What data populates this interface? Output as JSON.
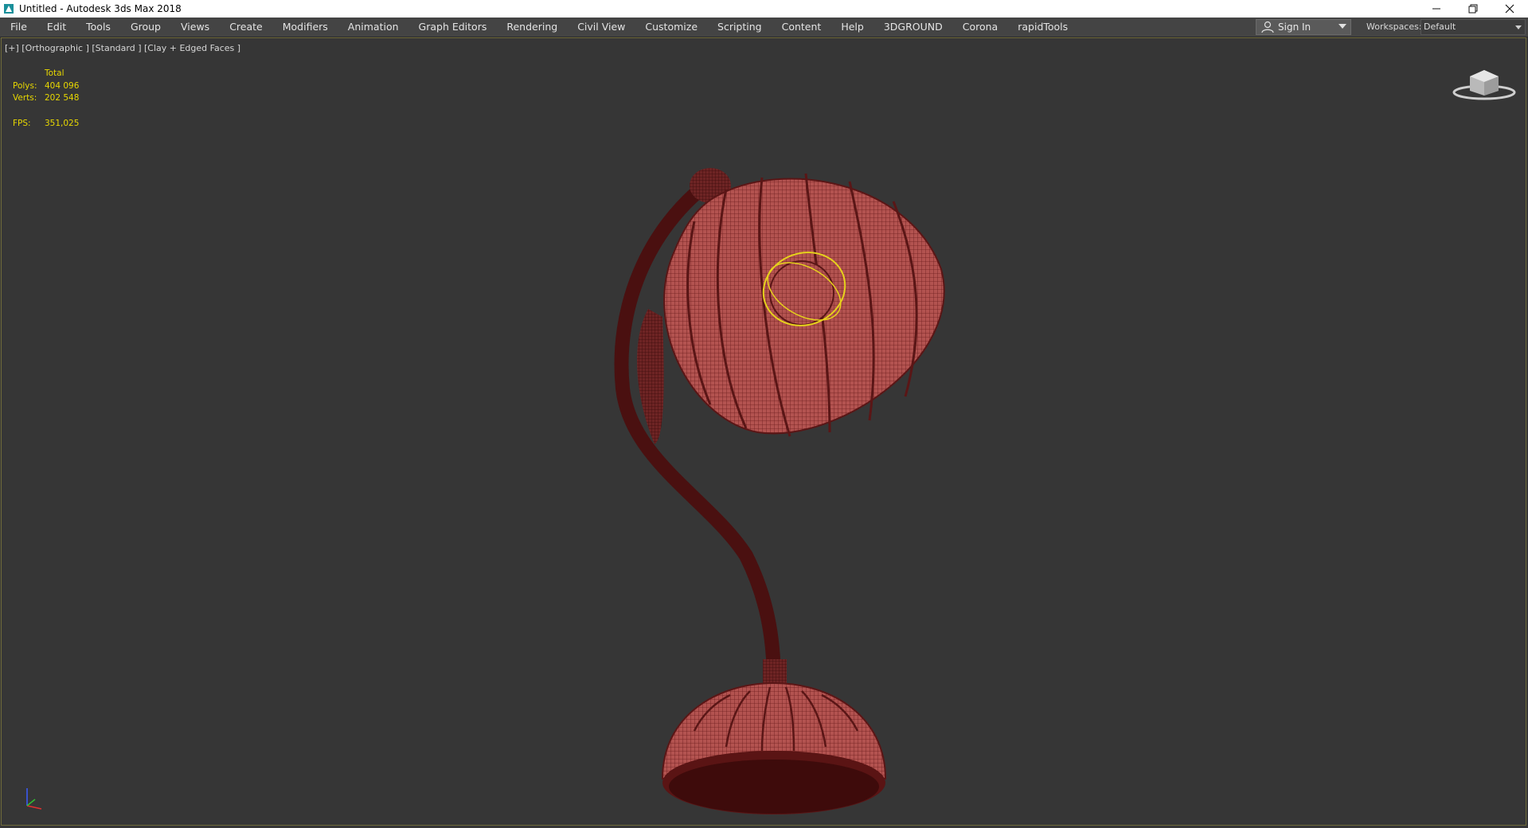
{
  "window": {
    "title": "Untitled - Autodesk 3ds Max 2018",
    "controls": [
      "minimize-icon",
      "restore-icon",
      "close-icon"
    ]
  },
  "menubar": {
    "items": [
      "File",
      "Edit",
      "Tools",
      "Group",
      "Views",
      "Create",
      "Modifiers",
      "Animation",
      "Graph Editors",
      "Rendering",
      "Civil View",
      "Customize",
      "Scripting",
      "Content",
      "Help",
      "3DGROUND",
      "Corona",
      "rapidTools"
    ],
    "sign_in": "Sign In",
    "workspaces_label": "Workspaces:",
    "workspace_value": "Default"
  },
  "viewport": {
    "label": "[+] [Orthographic ] [Standard ] [Clay + Edged Faces ]",
    "stats": {
      "header": "Total",
      "polys_label": "Polys:",
      "polys_value": "404 096",
      "verts_label": "Verts:",
      "verts_value": "202 548",
      "fps_label": "FPS:",
      "fps_value": "351,025"
    },
    "colors": {
      "background": "#363636",
      "stats_text": "#e8d800",
      "model_fill": "#b35350",
      "model_wire": "#5a1616",
      "selection": "#e6d21c"
    }
  }
}
